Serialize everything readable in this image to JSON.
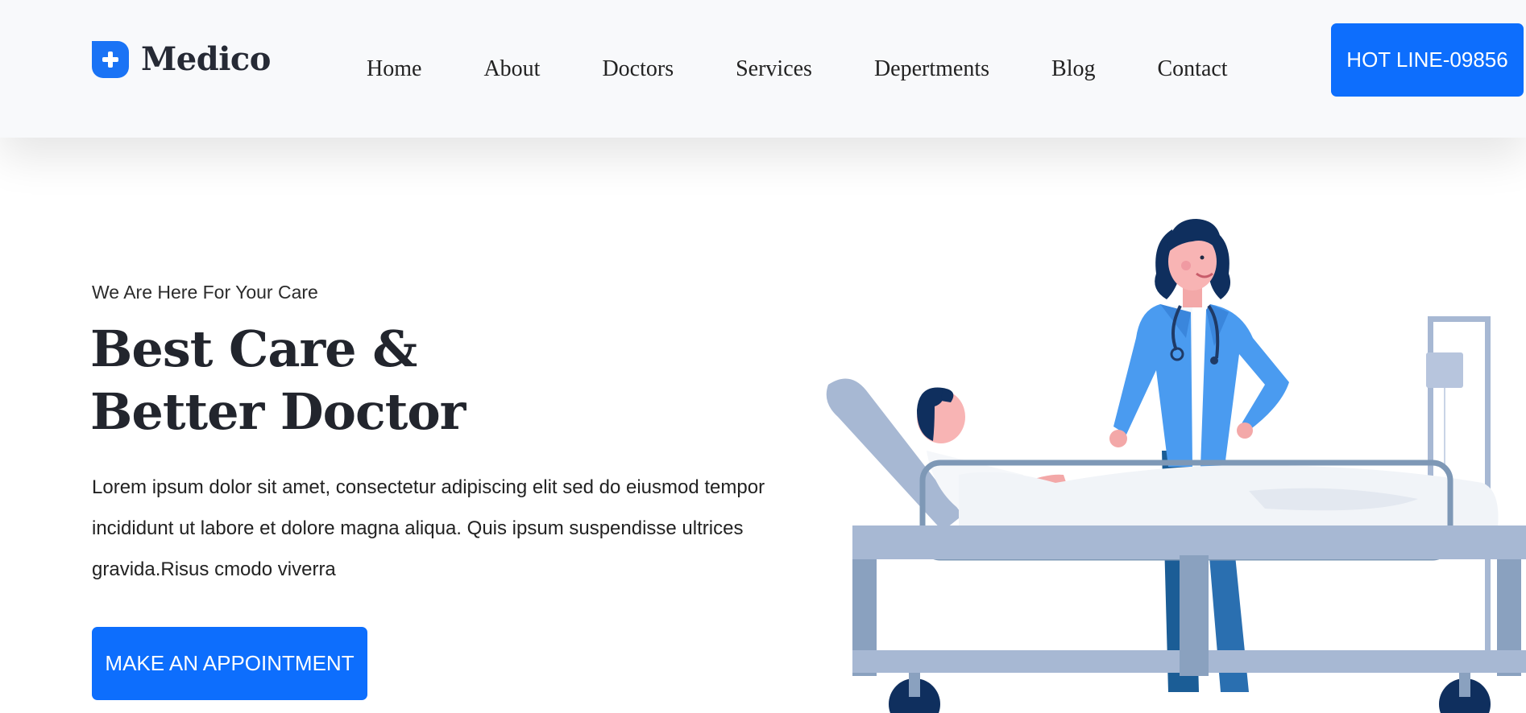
{
  "header": {
    "brand": "Medico",
    "logo_icon": "medical-cross-icon",
    "nav": [
      "Home",
      "About",
      "Doctors",
      "Services",
      "Depertments",
      "Blog",
      "Contact"
    ],
    "hotline_label": "HOT LINE-09856"
  },
  "hero": {
    "tagline": "We Are Here For Your Care",
    "headline_line1": "Best Care &",
    "headline_line2": "Better Doctor",
    "description": "Lorem ipsum dolor sit amet, consectetur adipiscing elit sed do eiusmod tempor incididunt ut labore et dolore magna aliqua. Quis ipsum suspendisse ultrices gravida.Risus cmodo viverra",
    "cta_label": "MAKE AN APPOINTMENT",
    "illustration": "doctor-with-patient-in-bed-illustration"
  },
  "colors": {
    "primary": "#0d6efd",
    "heading": "#22252d",
    "header_bg": "#f8f9fb",
    "coat": "#4a9bf0",
    "bed": "#a7b8d3"
  }
}
